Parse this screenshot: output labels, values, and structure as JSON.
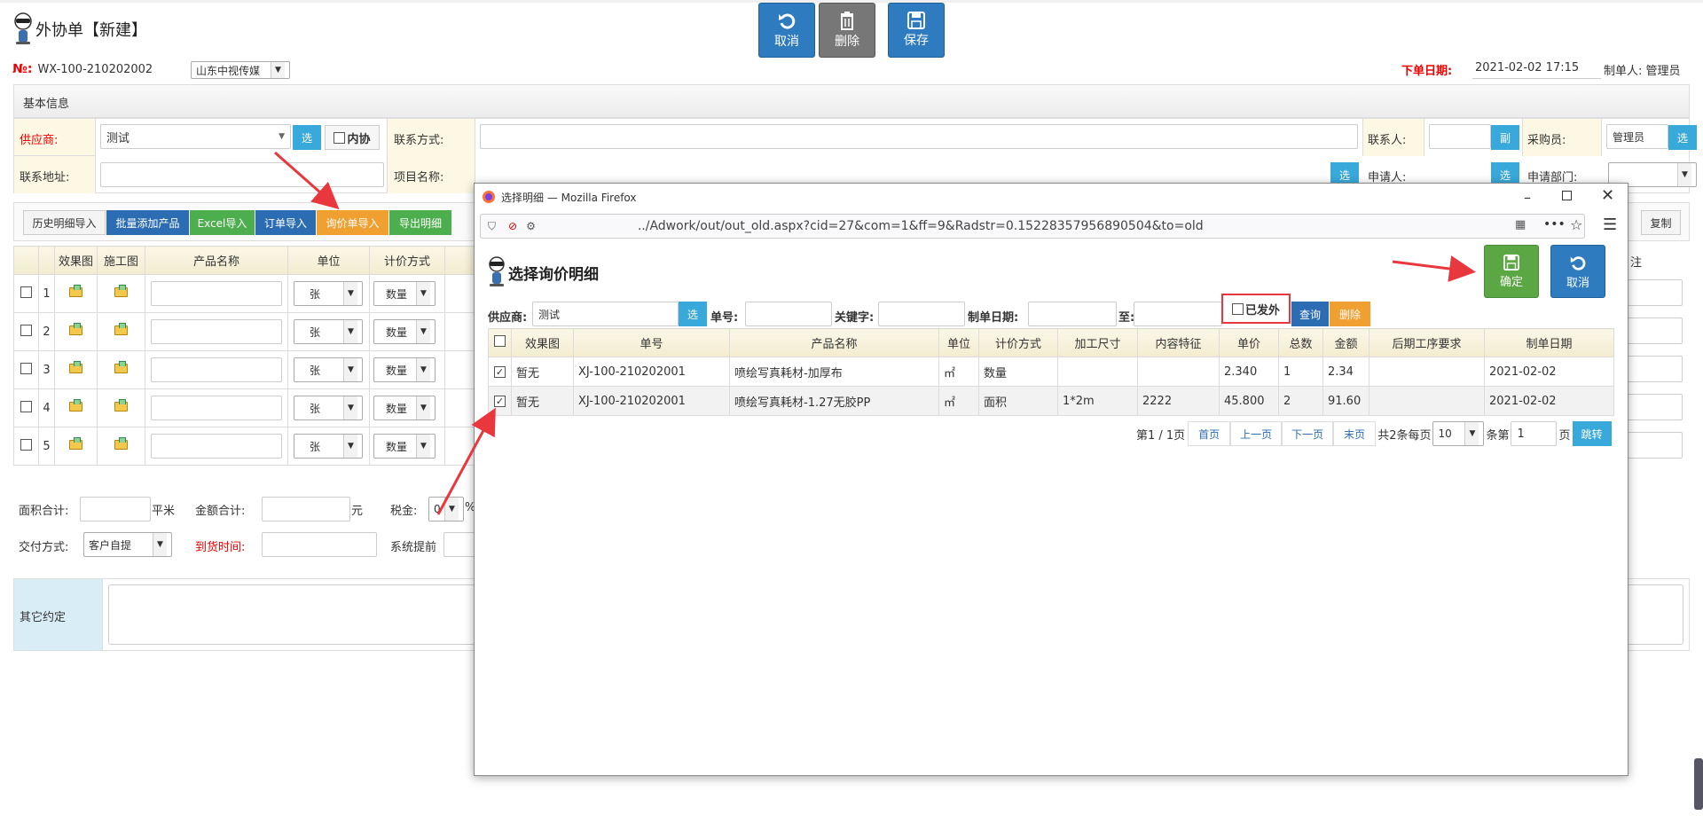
{
  "page": {
    "title": "外协单【新建】",
    "order_no_label": "№:",
    "order_no": "WX-100-210202002",
    "company": "山东中视传媒",
    "order_date_label": "下单日期:",
    "order_date": "2021-02-02 17:15",
    "creator_label": "制单人:",
    "creator": "管理员"
  },
  "toolbar": {
    "cancel": "取消",
    "delete": "删除",
    "save": "保存"
  },
  "basic": {
    "section_title": "基本信息",
    "supplier_label": "供应商:",
    "supplier_value": "测试",
    "select_btn": "选",
    "inner_label": "内协",
    "contact_method_label": "联系方式:",
    "contact_person_label": "联系人:",
    "contact_person_btn": "副",
    "buyer_label": "采购员:",
    "buyer_value": "管理员",
    "address_label": "联系地址:",
    "project_label": "项目名称:",
    "applicant_label": "申请人:",
    "dept_label": "申请部门:"
  },
  "import_bar": {
    "history": "历史明细导入",
    "batch": "批量添加产品",
    "excel": "Excel导入",
    "order": "订单导入",
    "inquiry": "询价单导入",
    "export": "导出明细",
    "copy": "复制"
  },
  "detail": {
    "headers": [
      "效果图",
      "施工图",
      "产品名称",
      "单位",
      "计价方式"
    ],
    "remark_header": "注",
    "rows": [
      {
        "no": "1",
        "unit": "张",
        "pricing": "数量"
      },
      {
        "no": "2",
        "unit": "张",
        "pricing": "数量"
      },
      {
        "no": "3",
        "unit": "张",
        "pricing": "数量"
      },
      {
        "no": "4",
        "unit": "张",
        "pricing": "数量"
      },
      {
        "no": "5",
        "unit": "张",
        "pricing": "数量"
      }
    ]
  },
  "summary": {
    "area_label": "面积合计:",
    "area_unit": "平米",
    "amount_label": "金额合计:",
    "amount_unit": "元",
    "tax_label": "税金:",
    "tax_value": "0",
    "tax_unit": "%",
    "delivery_label": "交付方式:",
    "delivery_value": "客户自提",
    "arrival_label": "到货时间:",
    "remind_label": "系统提前",
    "other_label": "其它约定"
  },
  "popup": {
    "window_title": "选择明细 — Mozilla Firefox",
    "url": "../Adwork/out/out_old.aspx?cid=27&com=1&ff=9&Radstr=0.15228357956890504&to=old",
    "heading": "选择询价明细",
    "confirm": "确定",
    "cancel": "取消",
    "filter": {
      "supplier_label": "供应商:",
      "supplier_value": "测试",
      "select_btn": "选",
      "no_label": "单号:",
      "keyword_label": "关键字:",
      "date_label": "制单日期:",
      "to_label": "至:",
      "outsourced_label": "已发外",
      "query": "查询",
      "delete": "删除"
    },
    "table": {
      "headers": [
        "效果图",
        "单号",
        "产品名称",
        "单位",
        "计价方式",
        "加工尺寸",
        "内容特征",
        "单价",
        "总数",
        "金额",
        "后期工序要求",
        "制单日期"
      ],
      "rows": [
        {
          "checked": true,
          "img": "暂无",
          "no": "XJ-100-210202001",
          "name": "喷绘写真耗材-加厚布",
          "unit": "㎡",
          "pricing": "数量",
          "size": "",
          "feature": "",
          "price": "2.340",
          "qty": "1",
          "amount": "2.34",
          "process": "",
          "date": "2021-02-02"
        },
        {
          "checked": true,
          "img": "暂无",
          "no": "XJ-100-210202001",
          "name": "喷绘写真耗材-1.27无胶PP",
          "unit": "㎡",
          "pricing": "面积",
          "size": "1*2m",
          "feature": "2222",
          "price": "45.800",
          "qty": "2",
          "amount": "91.60",
          "process": "",
          "date": "2021-02-02"
        }
      ]
    },
    "pager": {
      "page_info": "第1 / 1页",
      "first": "首页",
      "prev": "上一页",
      "next": "下一页",
      "last": "末页",
      "total_text": "共2条每页",
      "page_size": "10",
      "per_text": "条第",
      "page_num": "1",
      "page_text": "页",
      "jump": "跳转"
    }
  },
  "colors": {
    "blue_btn": "#2e7bbf",
    "gray_btn": "#777777",
    "green_btn": "#5aa743",
    "orange_btn": "#f0a030",
    "annotation_red": "#e8383d",
    "label_bg": "#fcf8e3"
  }
}
